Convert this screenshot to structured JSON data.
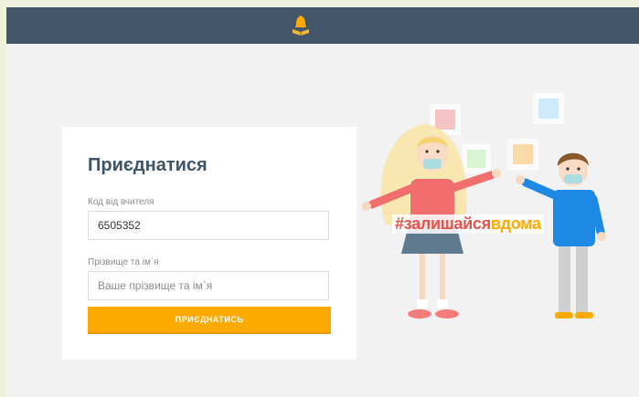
{
  "header": {
    "logo_icon": "bell-book-icon",
    "accent": "#ffaa00",
    "bar_color": "#435669"
  },
  "form": {
    "title": "Приєднатися",
    "code_label": "Код від вчителя",
    "code_value": "6505352",
    "name_label": "Прізвище та ім`я",
    "name_placeholder": "Ваше прізвище та ім`я",
    "submit_label": "ПРИЄДНАТИСЬ"
  },
  "hero": {
    "hashtag_part1": "#залишайся",
    "hashtag_part2": "вдома"
  }
}
